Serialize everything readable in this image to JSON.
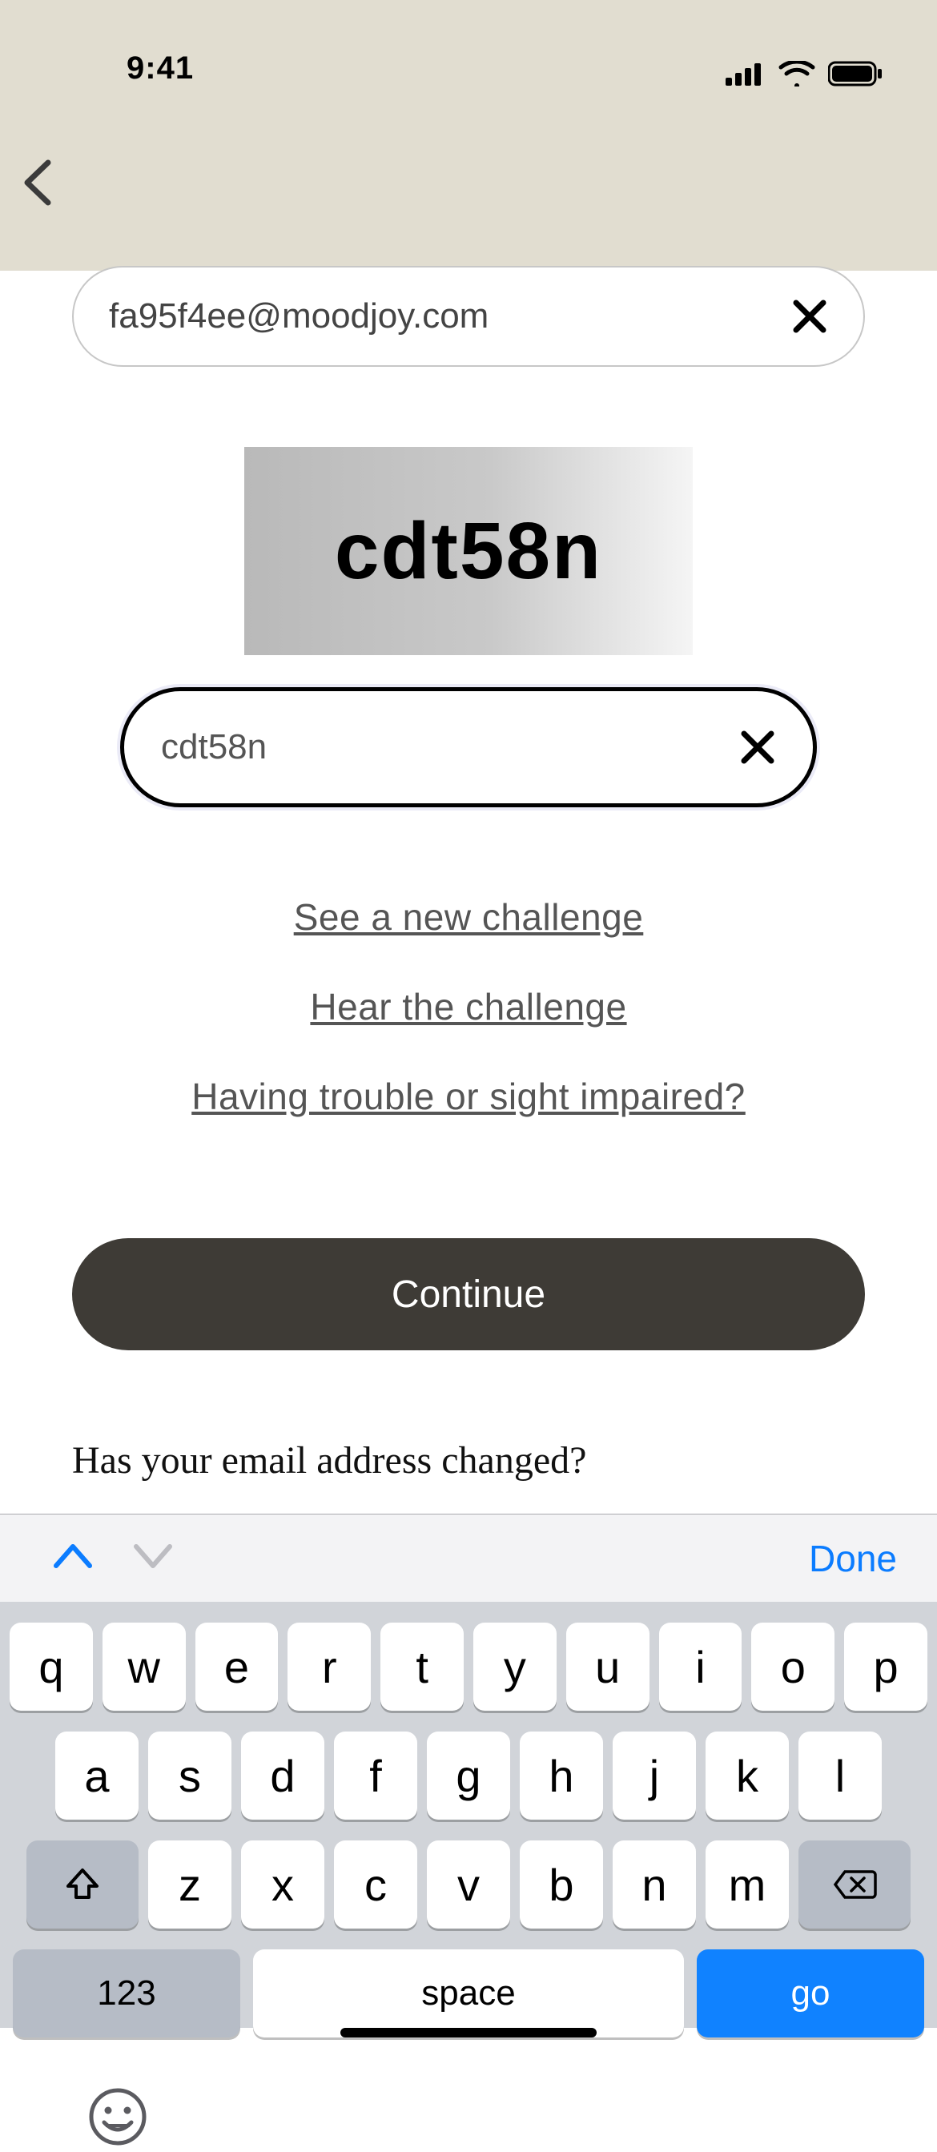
{
  "status": {
    "time": "9:41"
  },
  "form": {
    "email_value": "fa95f4ee@moodjoy.com",
    "captcha_image_text": "cdt58n",
    "captcha_input_value": "cdt58n"
  },
  "links": {
    "new_challenge": "See a new challenge",
    "hear_challenge": "Hear the challenge",
    "trouble": "Having trouble or sight impaired?"
  },
  "buttons": {
    "continue": "Continue"
  },
  "prompt": {
    "email_changed": "Has your email address changed?"
  },
  "keyboard": {
    "accessory": {
      "done": "Done"
    },
    "row1": [
      "q",
      "w",
      "e",
      "r",
      "t",
      "y",
      "u",
      "i",
      "o",
      "p"
    ],
    "row2": [
      "a",
      "s",
      "d",
      "f",
      "g",
      "h",
      "j",
      "k",
      "l"
    ],
    "row3": [
      "z",
      "x",
      "c",
      "v",
      "b",
      "n",
      "m"
    ],
    "numbers": "123",
    "space": "space",
    "go": "go"
  }
}
